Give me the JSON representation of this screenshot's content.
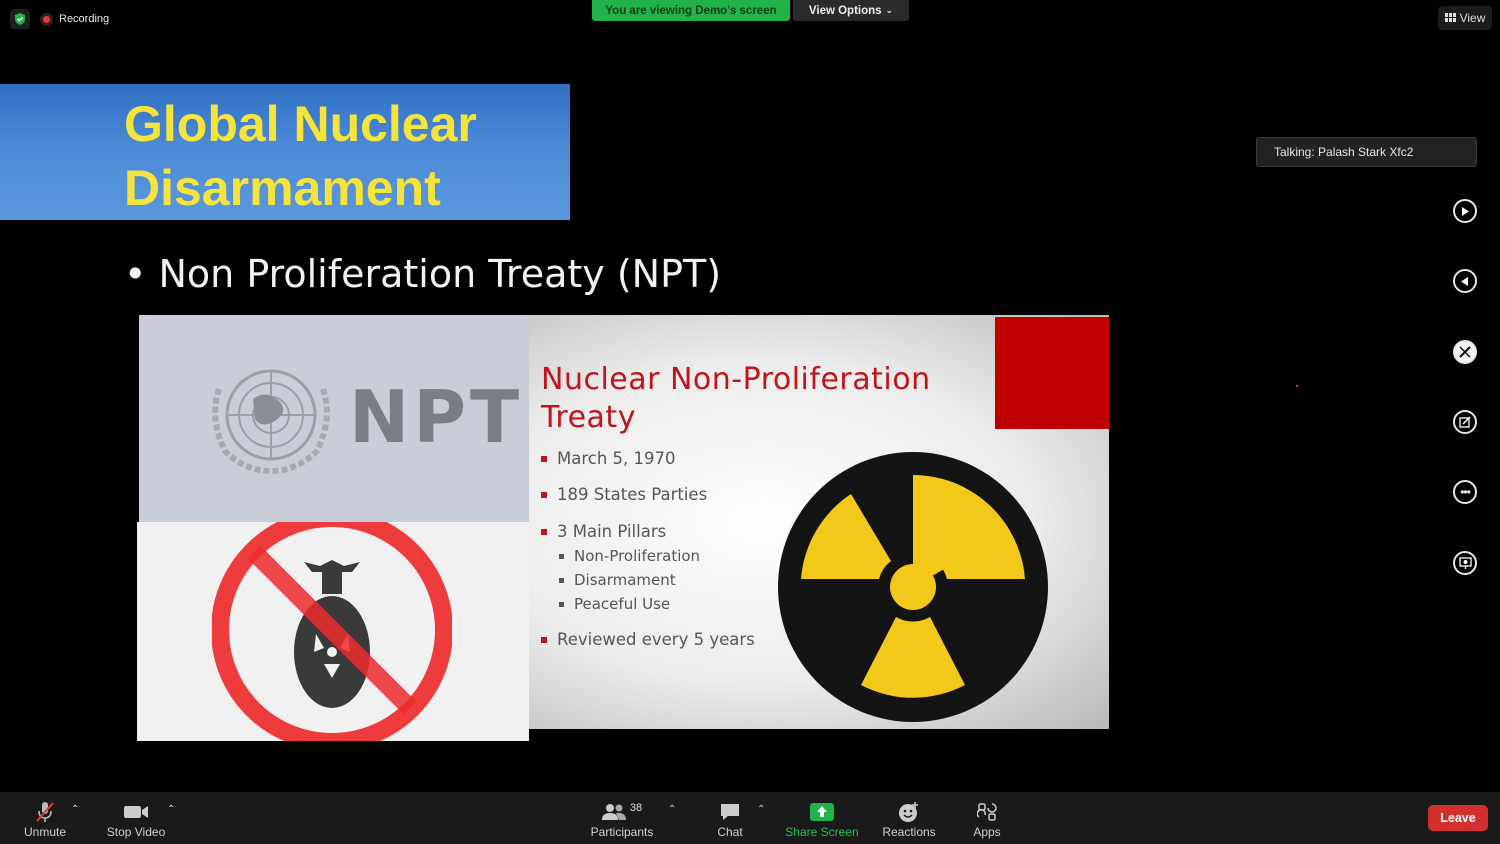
{
  "top_bar": {
    "recording_label": "Recording",
    "viewing_banner": "You are viewing Demo's screen",
    "view_options_label": "View Options",
    "view_label": "View"
  },
  "slide": {
    "title_line1": "Global Nuclear",
    "title_line2": "Disarmament",
    "bullet": "Non Proliferation Treaty (NPT)",
    "npt_logo_text": "NPT",
    "npt_title_line1": "Nuclear Non-Proliferation",
    "npt_title_line2": "Treaty",
    "npt_points": [
      {
        "text": "March 5, 1970",
        "level": 1
      },
      {
        "text": "189 States Parties",
        "level": 1
      },
      {
        "text": "3 Main Pillars",
        "level": 1
      },
      {
        "text": "Non-Proliferation",
        "level": 2
      },
      {
        "text": "Disarmament",
        "level": 2
      },
      {
        "text": "Peaceful Use",
        "level": 2
      },
      {
        "text": "Reviewed every 5 years",
        "level": 1
      }
    ]
  },
  "side_panel": {
    "talking_label": "Talking: Palash Stark Xfc2"
  },
  "toolbar": {
    "unmute_label": "Unmute",
    "stop_video_label": "Stop Video",
    "participants_label": "Participants",
    "participants_count": "38",
    "chat_label": "Chat",
    "share_screen_label": "Share Screen",
    "reactions_label": "Reactions",
    "apps_label": "Apps",
    "leave_label": "Leave"
  },
  "colors": {
    "title_text": "#f7e43a",
    "share_green": "#21b34a",
    "leave_red": "#d32f2f",
    "npt_red": "#c0141b"
  }
}
